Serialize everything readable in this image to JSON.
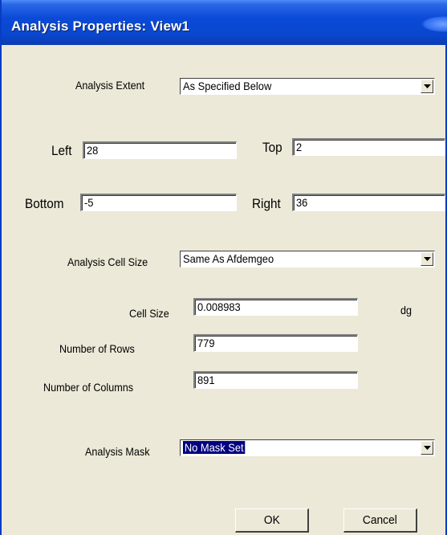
{
  "window": {
    "title": "Analysis Properties: View1"
  },
  "extent": {
    "label": "Analysis Extent",
    "value": "As Specified Below"
  },
  "bounds": {
    "left_label": "Left",
    "left_value": "28",
    "top_label": "Top",
    "top_value": "2",
    "bottom_label": "Bottom",
    "bottom_value": "-5",
    "right_label": "Right",
    "right_value": "36"
  },
  "cellsize_select": {
    "label": "Analysis Cell Size",
    "value": "Same As Afdemgeo"
  },
  "cellsize": {
    "label": "Cell Size",
    "value": "0.008983",
    "unit": "dg"
  },
  "rows": {
    "label": "Number of Rows",
    "value": "779"
  },
  "columns": {
    "label": "Number of Columns",
    "value": "891"
  },
  "mask": {
    "label": "Analysis Mask",
    "value": "No Mask Set"
  },
  "buttons": {
    "ok": "OK",
    "cancel": "Cancel"
  },
  "colors": {
    "titlebar": "#0a4ad6",
    "dialog_bg": "#ece9d8",
    "selection": "#000080"
  }
}
